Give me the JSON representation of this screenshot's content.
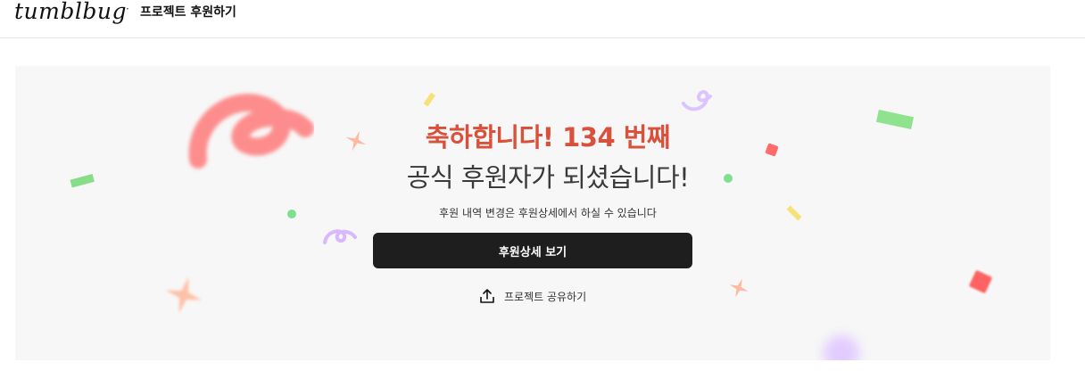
{
  "header": {
    "logo_text": "tumblbug",
    "separator": "·",
    "page_title": "프로젝트 후원하기"
  },
  "celebration": {
    "headline": "축하합니다! 134 번째",
    "subheadline": "공식 후원자가 되셨습니다!",
    "note": "후원 내역 변경은 후원상세에서 하실 수 있습니다",
    "primary_button_label": "후원상세 보기",
    "share_label": "프로젝트 공유하기",
    "share_icon": "share-upload-icon"
  },
  "colors": {
    "headline_accent": "#d9503b",
    "button_bg": "#1e1e1e",
    "panel_bg": "#f7f7f7"
  }
}
